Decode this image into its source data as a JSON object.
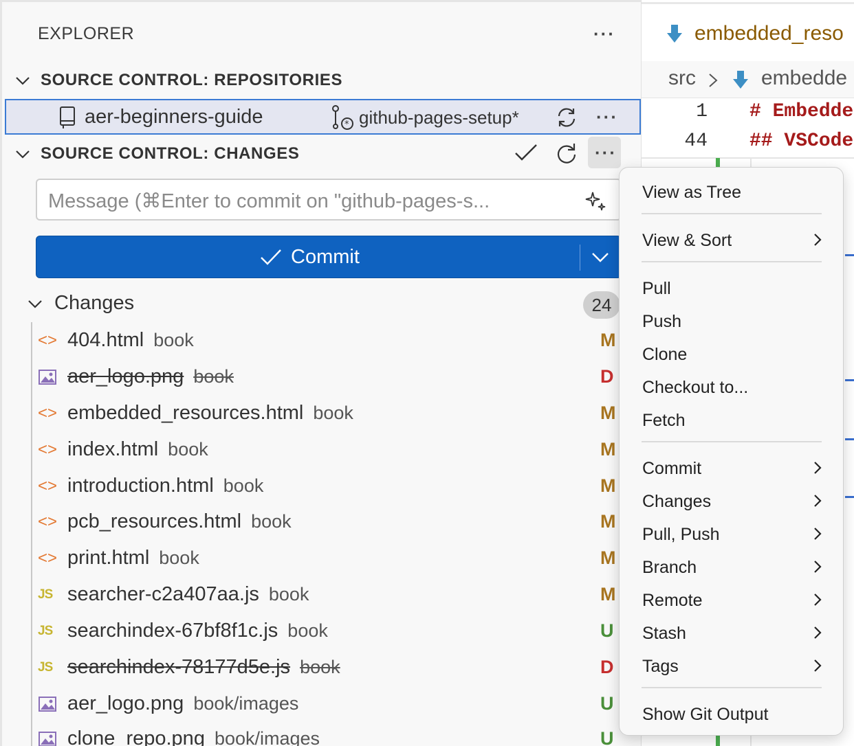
{
  "sidebar": {
    "title": "EXPLORER",
    "repos_section": "SOURCE CONTROL: REPOSITORIES",
    "repo": {
      "name": "aer-beginners-guide",
      "branch": "github-pages-setup*"
    },
    "changes_section": "SOURCE CONTROL: CHANGES",
    "message_placeholder": "Message (⌘Enter to commit on \"github-pages-s...",
    "commit_label": "Commit",
    "changes_group": "Changes",
    "changes_count": "24",
    "files": [
      {
        "name": "404.html",
        "dir": "book",
        "status": "M",
        "type": "html",
        "deleted": false
      },
      {
        "name": "aer_logo.png",
        "dir": "book",
        "status": "D",
        "type": "image",
        "deleted": true
      },
      {
        "name": "embedded_resources.html",
        "dir": "book",
        "status": "M",
        "type": "html",
        "deleted": false
      },
      {
        "name": "index.html",
        "dir": "book",
        "status": "M",
        "type": "html",
        "deleted": false
      },
      {
        "name": "introduction.html",
        "dir": "book",
        "status": "M",
        "type": "html",
        "deleted": false
      },
      {
        "name": "pcb_resources.html",
        "dir": "book",
        "status": "M",
        "type": "html",
        "deleted": false
      },
      {
        "name": "print.html",
        "dir": "book",
        "status": "M",
        "type": "html",
        "deleted": false
      },
      {
        "name": "searcher-c2a407aa.js",
        "dir": "book",
        "status": "M",
        "type": "js",
        "deleted": false
      },
      {
        "name": "searchindex-67bf8f1c.js",
        "dir": "book",
        "status": "U",
        "type": "js",
        "deleted": false
      },
      {
        "name": "searchindex-78177d5e.js",
        "dir": "book",
        "status": "D",
        "type": "js",
        "deleted": true
      },
      {
        "name": "aer_logo.png",
        "dir": "book/images",
        "status": "U",
        "type": "image",
        "deleted": false
      },
      {
        "name": "clone_repo.png",
        "dir": "book/images",
        "status": "U",
        "type": "image",
        "deleted": false
      }
    ]
  },
  "editor": {
    "tab_title": "embedded_reso",
    "breadcrumb": {
      "folder": "src",
      "file": "embedde"
    },
    "lines": [
      {
        "num": "1",
        "text": "# Embedde"
      },
      {
        "num": "44",
        "text": "## VSCode"
      }
    ]
  },
  "menu": {
    "items": [
      {
        "label": "View as Tree",
        "submenu": false
      },
      {
        "label": "View & Sort",
        "submenu": true
      },
      {
        "label": "Pull",
        "submenu": false
      },
      {
        "label": "Push",
        "submenu": false
      },
      {
        "label": "Clone",
        "submenu": false
      },
      {
        "label": "Checkout to...",
        "submenu": false
      },
      {
        "label": "Fetch",
        "submenu": false
      },
      {
        "label": "Commit",
        "submenu": true
      },
      {
        "label": "Changes",
        "submenu": true
      },
      {
        "label": "Pull, Push",
        "submenu": true
      },
      {
        "label": "Branch",
        "submenu": true
      },
      {
        "label": "Remote",
        "submenu": true
      },
      {
        "label": "Stash",
        "submenu": true
      },
      {
        "label": "Tags",
        "submenu": true
      },
      {
        "label": "Show Git Output",
        "submenu": false
      }
    ]
  },
  "colors": {
    "commit_button": "#0f62c0",
    "status_modified": "#a87520",
    "status_deleted": "#c62f2f",
    "status_untracked": "#4a8f3a"
  }
}
